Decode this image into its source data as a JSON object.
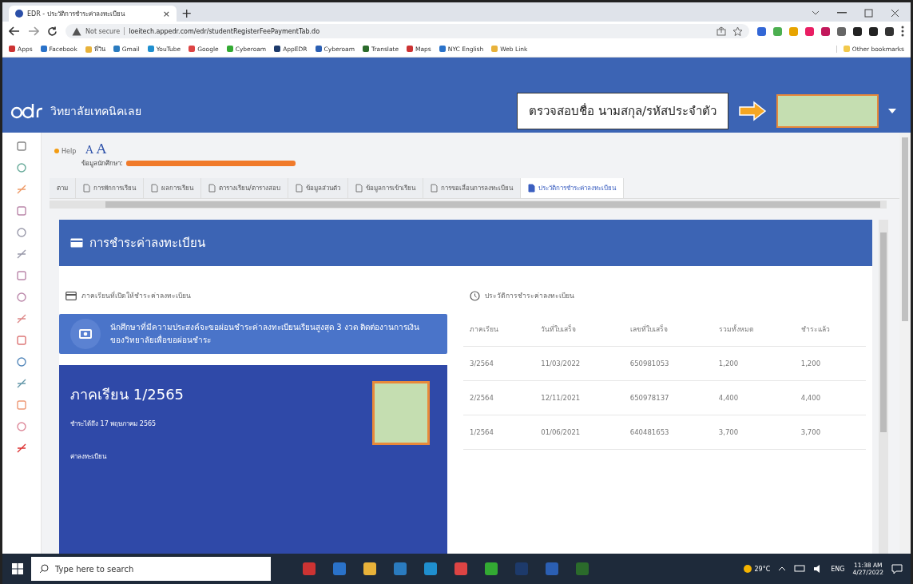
{
  "browser": {
    "tab": {
      "title": "EDR - ประวัติการชำระค่าลงทะเบียน",
      "close": "×"
    },
    "new_tab": "+",
    "security": "Not secure",
    "url": "loeitech.appedr.com/edr/studentRegisterFeePaymentTab.do",
    "bookmarks": [
      "Apps",
      "Facebook",
      "พี่วิน",
      "Gmail",
      "YouTube",
      "Google",
      "Cyberoam",
      "AppEDR",
      "Cyberoam",
      "Translate",
      "Maps",
      "NYC English",
      "Web Link"
    ],
    "other_bookmarks": "Other bookmarks"
  },
  "header": {
    "school": "วิทยาลัยเทคนิคเลย",
    "callout": "ตรวจสอบชื่อ นามสกุล/รหัสประจำตัว"
  },
  "toolbar": {
    "help": "Help",
    "font_small": "A",
    "font_large": "A",
    "student_label": "ข้อมูลนักศึกษา:"
  },
  "tabs": [
    {
      "label": "ตาม",
      "selected": false
    },
    {
      "label": "การพักการเรียน",
      "selected": false
    },
    {
      "label": "ผลการเรียน",
      "selected": false
    },
    {
      "label": "ตารางเรียน/ตารางสอบ",
      "selected": false
    },
    {
      "label": "ข้อมูลส่วนตัว",
      "selected": false
    },
    {
      "label": "ข้อมูลการเข้าเรียน",
      "selected": false
    },
    {
      "label": "การขอเลื่อนการลงทะเบียน",
      "selected": false
    },
    {
      "label": "ประวัติการชำระค่าลงทะเบียน",
      "selected": true
    }
  ],
  "card": {
    "title": "การชำระค่าลงทะเบียน",
    "open_terms": {
      "heading": "ภาคเรียนที่เปิดให้ชำระค่าลงทะเบียน",
      "notice": "นักศึกษาที่มีความประสงค์จะขอผ่อนชำระค่าลงทะเบียนเรียนสูงสุด 3 งวด ติดต่องานการเงินของวิทยาลัยเพื่อขอผ่อนชำระ",
      "term": {
        "title": "ภาคเรียน 1/2565",
        "due": "ชำระได้ถึง 17 พฤษภาคม 2565",
        "fee_label": "ค่าลงทะเบียน"
      }
    },
    "history": {
      "heading": "ประวัติการชำระค่าลงทะเบียน",
      "columns": [
        "ภาคเรียน",
        "วันที่ใบเสร็จ",
        "เลขที่ใบเสร็จ",
        "รวมทั้งหมด",
        "ชำระแล้ว"
      ],
      "rows": [
        [
          "3/2564",
          "11/03/2022",
          "650981053",
          "1,200",
          "1,200"
        ],
        [
          "2/2564",
          "12/11/2021",
          "650978137",
          "4,400",
          "4,400"
        ],
        [
          "1/2564",
          "01/06/2021",
          "640481653",
          "3,700",
          "3,700"
        ]
      ]
    }
  },
  "taskbar": {
    "search_placeholder": "Type here to search",
    "weather": "29°C",
    "language": "ENG",
    "time": "11:38 AM",
    "date": "4/27/2022"
  }
}
